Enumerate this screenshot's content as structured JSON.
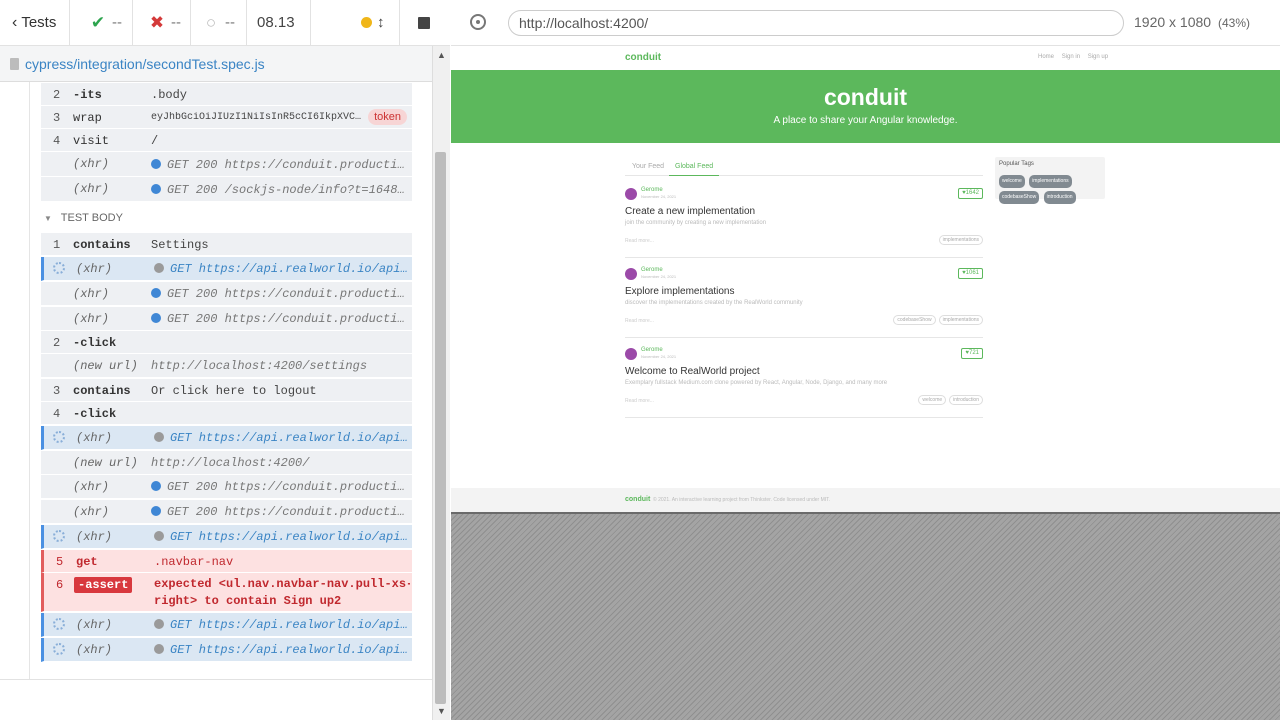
{
  "runner": {
    "tests_label": "Tests",
    "passed": "--",
    "failed": "--",
    "pending": "--",
    "duration": "08.13",
    "spec_file": "cypress/integration/secondTest.spec.js",
    "test_body_header": "TEST BODY"
  },
  "commands_pre": [
    {
      "num": "2",
      "name": "-its",
      "msg": ".body"
    },
    {
      "num": "3",
      "name": "wrap",
      "msg": "eyJhbGciOiJIUzI1NiIsInR5cCI6IkpXVCJ9...",
      "badge": "token"
    },
    {
      "num": "4",
      "name": "visit",
      "msg": "/"
    },
    {
      "num": "",
      "name": "(xhr)",
      "msg": "GET 200 https://conduit.production.."
    },
    {
      "num": "",
      "name": "(xhr)",
      "msg": "GET 200 /sockjs-node/info?t=164875.."
    }
  ],
  "commands_body": [
    {
      "num": "1",
      "name": "contains",
      "msg": "Settings"
    },
    {
      "num": "",
      "name": "(xhr)",
      "msg": "GET https://api.realworld.io/api/u..."
    },
    {
      "num": "",
      "name": "(xhr)",
      "msg": "GET 200 https://conduit.production.."
    },
    {
      "num": "",
      "name": "(xhr)",
      "msg": "GET 200 https://conduit.production.."
    },
    {
      "num": "2",
      "name": "-click",
      "msg": ""
    },
    {
      "num": "",
      "name": "(new url)",
      "msg": "http://localhost:4200/settings"
    },
    {
      "num": "3",
      "name": "contains",
      "msg": "Or click here to logout"
    },
    {
      "num": "4",
      "name": "-click",
      "msg": ""
    },
    {
      "num": "",
      "name": "(xhr)",
      "msg": "GET https://api.realworld.io/api/t..."
    },
    {
      "num": "",
      "name": "(new url)",
      "msg": "http://localhost:4200/"
    },
    {
      "num": "",
      "name": "(xhr)",
      "msg": "GET 200 https://conduit.production.."
    },
    {
      "num": "",
      "name": "(xhr)",
      "msg": "GET 200 https://conduit.production.."
    },
    {
      "num": "",
      "name": "(xhr)",
      "msg": "GET https://api.realworld.io/api/a..."
    },
    {
      "num": "5",
      "name": "get",
      "msg": ".navbar-nav"
    },
    {
      "num": "6",
      "name": "-assert",
      "msg_line1": "expected  <ul.nav.navbar-nav.pull-xs-",
      "msg_line2": "right>  to contain  Sign up2"
    },
    {
      "num": "",
      "name": "(xhr)",
      "msg": "GET https://api.realworld.io/api/t..."
    },
    {
      "num": "",
      "name": "(xhr)",
      "msg": "GET https://api.realworld.io/api/a..."
    }
  ],
  "browser": {
    "url": "http://localhost:4200/",
    "viewport": "1920 x 1080",
    "scale": "(43%)"
  },
  "app": {
    "brand": "conduit",
    "nav_links": [
      "Home",
      "Sign in",
      "Sign up"
    ],
    "banner_title": "conduit",
    "banner_sub": "A place to share your Angular knowledge.",
    "tabs": [
      "Your Feed",
      "Global Feed"
    ],
    "articles": [
      {
        "author": "Gerome",
        "date": "November 24, 2021",
        "likes": "1642",
        "title": "Create a new implementation",
        "desc": "join the community by creating a new implementation",
        "read": "Read more...",
        "tags": [
          "implementations"
        ]
      },
      {
        "author": "Gerome",
        "date": "November 24, 2021",
        "likes": "1061",
        "title": "Explore implementations",
        "desc": "discover the implementations created by the RealWorld community",
        "read": "Read more...",
        "tags": [
          "codebaseShow",
          "implementations"
        ]
      },
      {
        "author": "Gerome",
        "date": "November 24, 2021",
        "likes": "721",
        "title": "Welcome to RealWorld project",
        "desc": "Exemplary fullstack Medium.com clone powered by React, Angular, Node, Django, and many more",
        "read": "Read more...",
        "tags": [
          "welcome",
          "introduction"
        ]
      }
    ],
    "popular_tags_title": "Popular Tags",
    "popular_tags": [
      "welcome",
      "implementations",
      "codebaseShow",
      "introduction"
    ],
    "footer_brand": "conduit",
    "footer_text": "© 2021. An interactive learning project from Thinkster. Code licensed under MIT."
  },
  "colors": {
    "brand_green": "#5cb85c",
    "pass": "#2da44e",
    "fail": "#d43a3a",
    "error_bg": "#fde1e1",
    "pending_xhr_bg": "#dbe7f3"
  }
}
